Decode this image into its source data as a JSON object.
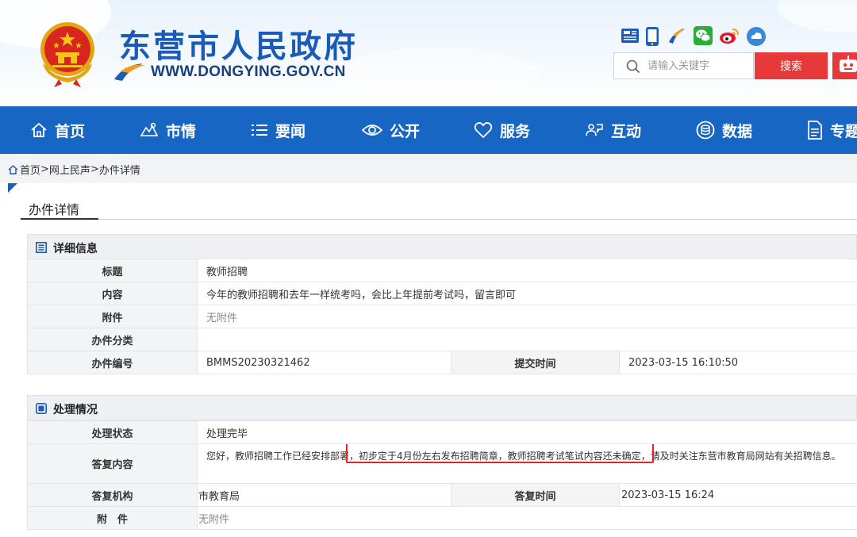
{
  "header": {
    "title": "东营市人民政府",
    "url": "WWW.DONGYING.GOV.CN",
    "social_icons": [
      "newspaper-icon",
      "mobile-icon",
      "flame-logo-icon",
      "wechat-icon",
      "weibo-icon",
      "cloud-app-icon"
    ],
    "search": {
      "placeholder": "请输入关键字",
      "button_label": "搜索"
    }
  },
  "nav": {
    "items": [
      {
        "label": "首页",
        "icon": "home-icon"
      },
      {
        "label": "市情",
        "icon": "city-icon"
      },
      {
        "label": "要闻",
        "icon": "list-icon"
      },
      {
        "label": "公开",
        "icon": "eye-icon"
      },
      {
        "label": "服务",
        "icon": "heart-icon"
      },
      {
        "label": "互动",
        "icon": "interact-icon"
      },
      {
        "label": "数据",
        "icon": "data-icon"
      },
      {
        "label": "专题",
        "icon": "document-icon"
      }
    ]
  },
  "breadcrumb": {
    "home": "首页",
    "sep": ">",
    "level1": "网上民声",
    "level2": "办件详情"
  },
  "page_heading": "办件详情",
  "detail": {
    "section_title": "详细信息",
    "title_label": "标题",
    "title_value": "教师招聘",
    "content_label": "内容",
    "content_value": "今年的教师招聘和去年一样统考吗，会比上年提前考试吗，留言即可",
    "attachment_label": "附件",
    "attachment_value": "无附件",
    "category_label": "办件分类",
    "category_value": "",
    "number_label": "办件编号",
    "number_value": "BMMS20230321462",
    "submit_time_label": "提交时间",
    "submit_time_value": "2023-03-15 16:10:50"
  },
  "processing": {
    "section_title": "处理情况",
    "status_label": "处理状态",
    "status_value": "处理完毕",
    "reply_label": "答复内容",
    "reply_value": "您好，教师招聘工作已经安排部署，初步定于4月份左右发布招聘简章，教师招聘考试笔试内容还未确定，请及时关注东营市教育局网站有关招聘信息。",
    "org_label": "答复机构",
    "org_value": "市教育局",
    "reply_time_label": "答复时间",
    "reply_time_value": "2023-03-15 16:24",
    "attachment_label": "附　件",
    "attachment_value": "无附件"
  },
  "colors": {
    "nav_blue": "#1866c4",
    "search_red": "#e8393a",
    "highlight_red": "#e2242a",
    "title_blue": "#1a5ab8"
  }
}
